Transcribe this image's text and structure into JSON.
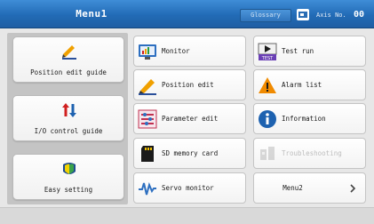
{
  "header": {
    "title": "Menu1",
    "glossary_label": "Glossary",
    "axis_label": "Axis No.",
    "axis_number": "00"
  },
  "left_menu": [
    {
      "label": "Position edit guide",
      "icon": "pencil-guide-icon"
    },
    {
      "label": "I/O control guide",
      "icon": "io-arrows-icon"
    },
    {
      "label": "Easy setting",
      "icon": "easy-setting-icon"
    }
  ],
  "grid": {
    "monitor": "Monitor",
    "test_run": "Test run",
    "position_edit": "Position edit",
    "alarm_list": "Alarm list",
    "parameter_edit": "Parameter edit",
    "information": "Information",
    "sd_memory_card": "SD memory card",
    "troubleshooting": "Troubleshooting",
    "servo_monitor": "Servo monitor",
    "menu2": "Menu2"
  },
  "colors": {
    "header_blue": "#226bb6",
    "alarm_orange": "#f08a00",
    "info_blue": "#1e62b0",
    "io_red": "#d02020"
  }
}
